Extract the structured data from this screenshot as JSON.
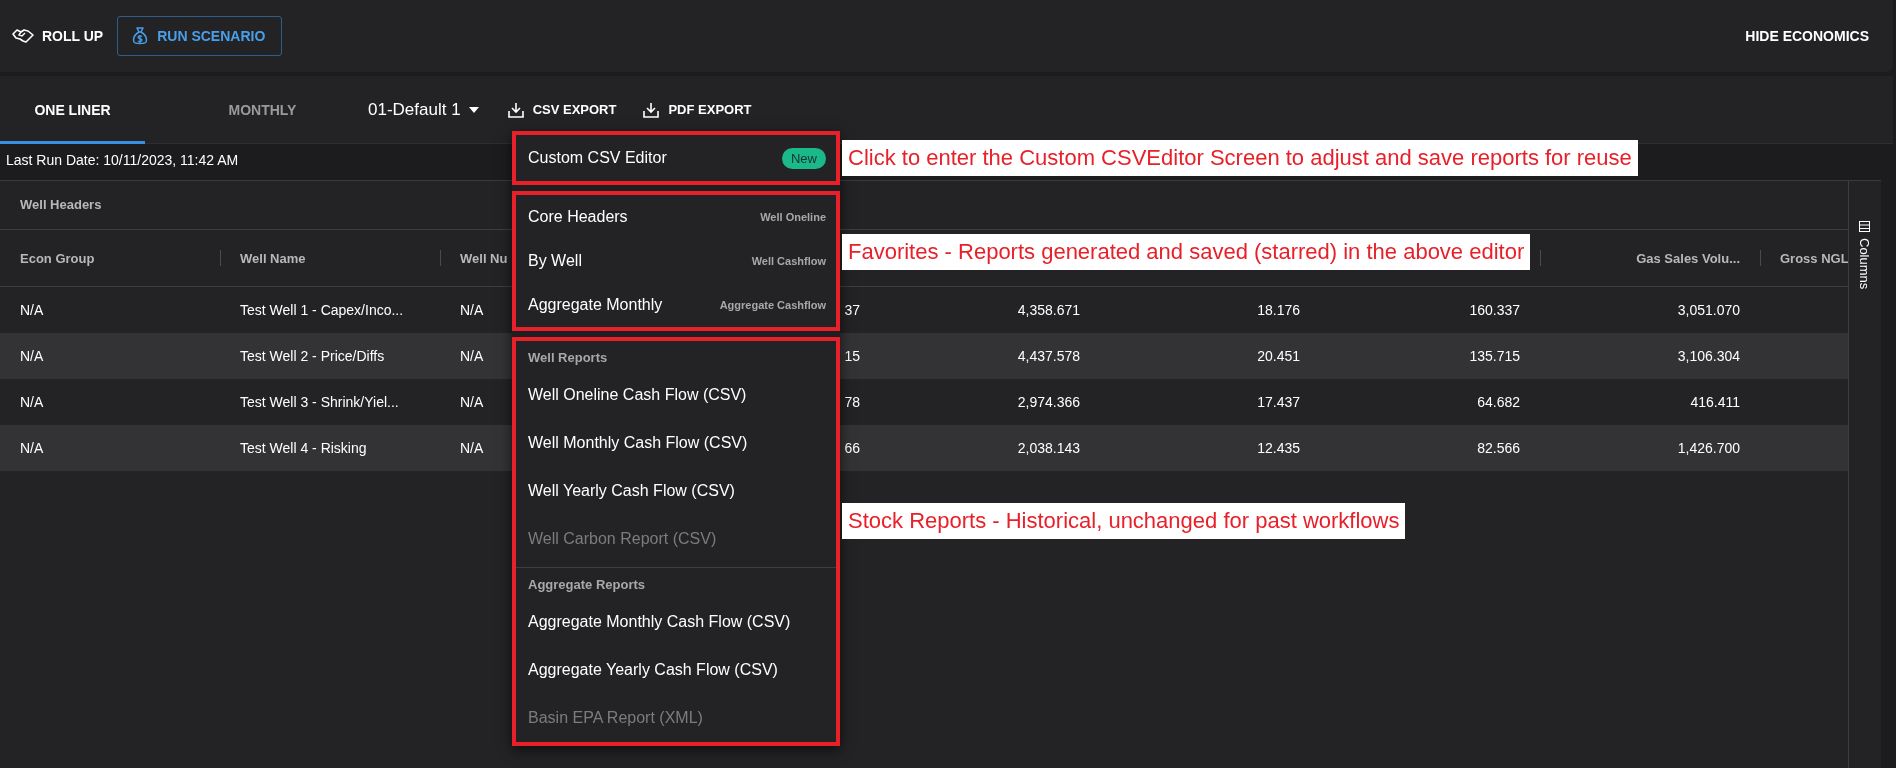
{
  "toolbar": {
    "roll_up": "ROLL UP",
    "run_scenario": "RUN SCENARIO",
    "hide_economics": "HIDE ECONOMICS"
  },
  "tabs": [
    {
      "label": "ONE LINER",
      "selected": true
    },
    {
      "label": "MONTHLY",
      "selected": false
    }
  ],
  "scenario_select": {
    "value": "01-Default 1"
  },
  "export_buttons": [
    "CSV EXPORT",
    "PDF EXPORT"
  ],
  "last_run": "Last Run Date: 10/11/2023, 11:42 AM",
  "table": {
    "group_header": "Well Headers",
    "columns": [
      {
        "label": "Econ Group",
        "kind": "text"
      },
      {
        "label": "Well Name",
        "kind": "text"
      },
      {
        "label": "Well Nu",
        "kind": "text"
      },
      {
        "kind": "number"
      },
      {
        "kind": "number"
      },
      {
        "kind": "number"
      },
      {
        "kind": "number"
      },
      {
        "label": "Gas Sales Volu...",
        "kind": "number"
      },
      {
        "label": "Gross NGL",
        "kind": "text"
      }
    ],
    "rows": [
      [
        "N/A",
        "Test Well 1 - Capex/Inco...",
        "N/A",
        "37",
        "4,358.671",
        "18.176",
        "160.337",
        "3,051.070"
      ],
      [
        "N/A",
        "Test Well 2 - Price/Diffs",
        "N/A",
        "15",
        "4,437.578",
        "20.451",
        "135.715",
        "3,106.304"
      ],
      [
        "N/A",
        "Test Well 3 - Shrink/Yiel...",
        "N/A",
        "78",
        "2,974.366",
        "17.437",
        "64.682",
        "416.411"
      ],
      [
        "N/A",
        "Test Well 4 - Risking",
        "N/A",
        "66",
        "2,038.143",
        "12.435",
        "82.566",
        "1,426.700"
      ]
    ]
  },
  "columns_panel": "Columns",
  "export_menu": {
    "sections": [
      {
        "kind": "editor",
        "callout": "Click to enter the Custom CSVEditor Screen to adjust and save reports for reuse",
        "groups": [
          {
            "items": [
              {
                "label": "Custom CSV Editor",
                "badge": "New",
                "disabled": false
              }
            ]
          }
        ]
      },
      {
        "kind": "favorites",
        "callout": "Favorites - Reports generated and saved (starred) in the above editor",
        "groups": [
          {
            "items": [
              {
                "label": "Core Headers",
                "report_type": "Well Oneline",
                "disabled": false
              },
              {
                "label": "By Well",
                "report_type": "Well Cashflow",
                "disabled": false
              },
              {
                "label": "Aggregate Monthly",
                "report_type": "Aggregate Cashflow",
                "disabled": false
              }
            ]
          }
        ]
      },
      {
        "kind": "stock",
        "callout": "Stock Reports - Historical, unchanged for past workflows",
        "groups": [
          {
            "title": "Well Reports",
            "items": [
              {
                "label": "Well Oneline Cash Flow (CSV)",
                "disabled": false
              },
              {
                "label": "Well Monthly Cash Flow (CSV)",
                "disabled": false
              },
              {
                "label": "Well Yearly Cash Flow (CSV)",
                "disabled": false
              },
              {
                "label": "Well Carbon Report (CSV)",
                "disabled": true
              }
            ]
          },
          {
            "title": "Aggregate Reports",
            "items": [
              {
                "label": "Aggregate Monthly Cash Flow (CSV)",
                "disabled": false
              },
              {
                "label": "Aggregate Yearly Cash Flow (CSV)",
                "disabled": false
              },
              {
                "label": "Basin EPA Report (XML)",
                "disabled": true
              }
            ]
          }
        ]
      }
    ]
  }
}
